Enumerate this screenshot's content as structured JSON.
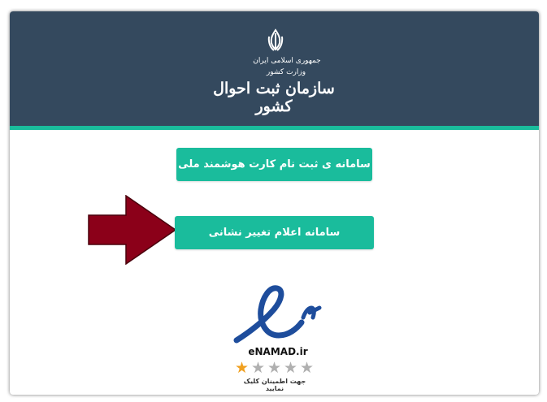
{
  "header": {
    "org_line1": "جمهوری اسلامی ایران",
    "org_line2": "وزارت کشور",
    "org_name": "سازمان ثبت احوال کشور"
  },
  "buttons": {
    "smart_card_registration": "سامانه ی ثبت نام کارت هوشمند ملی",
    "address_change": "سامانه اعلام تغییر نشانی"
  },
  "enamad": {
    "label": "eNAMAD.ir",
    "rating": 1,
    "rating_max": 5,
    "caption": "جهت اطمینان کلیک نمایید"
  },
  "colors": {
    "header_bg": "#34495e",
    "accent": "#1abc9c",
    "arrow": "#8b0019",
    "enamad_blue": "#1e4d9c"
  }
}
